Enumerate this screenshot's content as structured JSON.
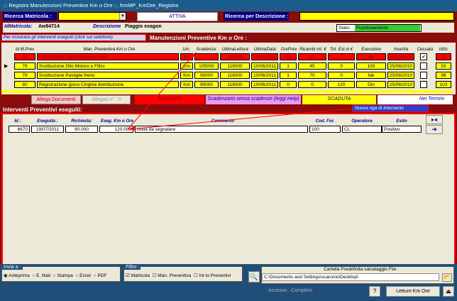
{
  "window": {
    "title": ".:: Registra Manutenzioni Preventive Km o Ore ::.   frmMP_KmOre_Registra"
  },
  "search": {
    "matricola_label": "Ricerca Matricola :",
    "matricola_value": "",
    "attiva_label": "ATTIVA",
    "desc_label": "Ricerca per Descrizione :",
    "desc_value": ""
  },
  "info": {
    "idmatricola_label": "IdMatricola:",
    "idmatricola_value": "Aw94714",
    "descrizione_label": "Descrizione",
    "descrizione_value": "Piaggio exagon",
    "stato_label": "Stato:",
    "stato_value": "Funzionamento"
  },
  "hint": "Per mostrare  gli interventi eseguiti (click sul selettore)",
  "section1_title": "Manutenzioni Preventive Km o Ore :",
  "upper_headers": [
    "Id M.Prev",
    "Man. Preventiva Km o Ore",
    "Um",
    "Scadenza:",
    "UltimaLettura:",
    "UltimaData:",
    "OrePrev",
    "Ricambi mt. €",
    "Tot. Est.ni €",
    "Esecutore",
    "Inserita",
    "Cessata",
    "IdSc"
  ],
  "upper_rows": [
    {
      "id": "34",
      "desc": "Sostituzione Candele accensione",
      "um": "km",
      "scad": "",
      "lett": "118000",
      "data": "10/06/2011",
      "ore": "0,5",
      "ric": "15",
      "tot": "7",
      "esec": "ale",
      "ins": "04/12/2008",
      "idsc": "92"
    },
    {
      "id": "78",
      "desc": "Sostituzione Olio Motore e Filtro",
      "um": "Km",
      "scad": "105000",
      "lett": "118000",
      "data": "10/06/2011",
      "ore": "1",
      "ric": "45",
      "tot": "0",
      "esec": "100",
      "ins": "25/08/2010",
      "idsc": "93"
    },
    {
      "id": "79",
      "desc": "Sostituzione Pastiglie freno",
      "um": "Km",
      "scad": "90000",
      "lett": "118000",
      "data": "10/06/2011",
      "ore": "1",
      "ric": "70",
      "tot": "0",
      "esec": "fab",
      "ins": "25/08/2010",
      "idsc": "98"
    },
    {
      "id": "80",
      "desc": "Registrazione gioco Cinghia distribuzione",
      "um": "Km",
      "scad": "90000",
      "lett": "118000",
      "data": "10/06/2011",
      "ore": "0",
      "ric": "0",
      "tot": "120",
      "esec": "Din",
      "ins": "25/08/2010",
      "idsc": "103"
    }
  ],
  "toolbar": {
    "allega": "Allega Documenti",
    "allegati": "Allegati n° : 0",
    "scaduta": "SCADUTA",
    "scadenzario": "Scadenzario senza scadenze (leggi Help)",
    "scaduta2": "SCADUTA",
    "nei_termini": "Nei Termini"
  },
  "section2_title": "Interventi Preventivi eseguiti:",
  "nuova_riga": "Nuova riga di Intervento",
  "lower_headers": {
    "id": "Id :",
    "eseguita": "Eseguita :",
    "richiesta": "Richiesta:",
    "eseg_km": "Eseg. Km o Ore",
    "commento": "Commento",
    "cod_for": "Cod. For.",
    "operatore": "Operatore",
    "esito": "Esito"
  },
  "lower_row": {
    "id": "6670",
    "eseguita": "19/07/2011",
    "richiesta": "90.000",
    "eseg_km": "120.000",
    "commento": "Nulla da segnalare",
    "cod_for": "100",
    "operatore": "CL",
    "esito": "Positivo"
  },
  "bottom": {
    "invia_label": "Invia a :",
    "invia_options": [
      "Anteprima",
      "E. Mail",
      "Stampa",
      "Excel",
      "PDF"
    ],
    "filtro_label": "Filtro :",
    "filtro_options": [
      "Matricola",
      "Man. Preventiva",
      "Int to Preventivi"
    ],
    "cartella_label": "Cartella Predefinita salvataggio File :",
    "cartella_value": "C:\\Documents and Settings\\scaronio\\Desktop\\",
    "accesso": "Accesso : Completo",
    "letture": "Letture Km Ore"
  }
}
